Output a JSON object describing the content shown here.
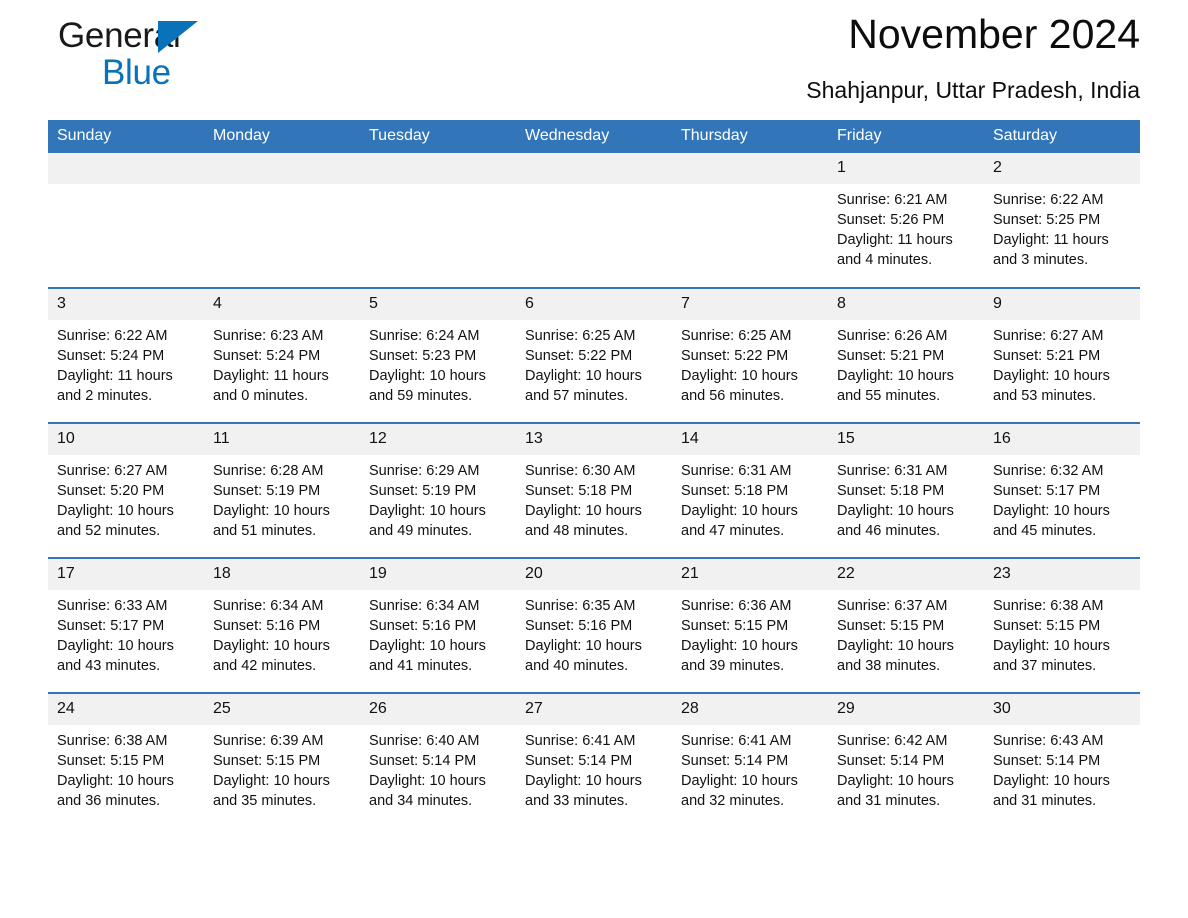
{
  "brand": {
    "name_part1": "General",
    "name_part2": "Blue",
    "triangle_color": "#0a72b8",
    "accent_color": "#3275b8"
  },
  "header": {
    "title": "November 2024",
    "subtitle": "Shahjanpur, Uttar Pradesh, India"
  },
  "calendar": {
    "weekday_headers": [
      "Sunday",
      "Monday",
      "Tuesday",
      "Wednesday",
      "Thursday",
      "Friday",
      "Saturday"
    ],
    "header_bg": "#3275b8",
    "header_text_color": "#ffffff",
    "daynum_bg": "#f1f1f1",
    "weeks": [
      [
        {
          "day": "",
          "sunrise": "",
          "sunset": "",
          "daylight_line1": "",
          "daylight_line2": ""
        },
        {
          "day": "",
          "sunrise": "",
          "sunset": "",
          "daylight_line1": "",
          "daylight_line2": ""
        },
        {
          "day": "",
          "sunrise": "",
          "sunset": "",
          "daylight_line1": "",
          "daylight_line2": ""
        },
        {
          "day": "",
          "sunrise": "",
          "sunset": "",
          "daylight_line1": "",
          "daylight_line2": ""
        },
        {
          "day": "",
          "sunrise": "",
          "sunset": "",
          "daylight_line1": "",
          "daylight_line2": ""
        },
        {
          "day": "1",
          "sunrise": "Sunrise: 6:21 AM",
          "sunset": "Sunset: 5:26 PM",
          "daylight_line1": "Daylight: 11 hours",
          "daylight_line2": "and 4 minutes."
        },
        {
          "day": "2",
          "sunrise": "Sunrise: 6:22 AM",
          "sunset": "Sunset: 5:25 PM",
          "daylight_line1": "Daylight: 11 hours",
          "daylight_line2": "and 3 minutes."
        }
      ],
      [
        {
          "day": "3",
          "sunrise": "Sunrise: 6:22 AM",
          "sunset": "Sunset: 5:24 PM",
          "daylight_line1": "Daylight: 11 hours",
          "daylight_line2": "and 2 minutes."
        },
        {
          "day": "4",
          "sunrise": "Sunrise: 6:23 AM",
          "sunset": "Sunset: 5:24 PM",
          "daylight_line1": "Daylight: 11 hours",
          "daylight_line2": "and 0 minutes."
        },
        {
          "day": "5",
          "sunrise": "Sunrise: 6:24 AM",
          "sunset": "Sunset: 5:23 PM",
          "daylight_line1": "Daylight: 10 hours",
          "daylight_line2": "and 59 minutes."
        },
        {
          "day": "6",
          "sunrise": "Sunrise: 6:25 AM",
          "sunset": "Sunset: 5:22 PM",
          "daylight_line1": "Daylight: 10 hours",
          "daylight_line2": "and 57 minutes."
        },
        {
          "day": "7",
          "sunrise": "Sunrise: 6:25 AM",
          "sunset": "Sunset: 5:22 PM",
          "daylight_line1": "Daylight: 10 hours",
          "daylight_line2": "and 56 minutes."
        },
        {
          "day": "8",
          "sunrise": "Sunrise: 6:26 AM",
          "sunset": "Sunset: 5:21 PM",
          "daylight_line1": "Daylight: 10 hours",
          "daylight_line2": "and 55 minutes."
        },
        {
          "day": "9",
          "sunrise": "Sunrise: 6:27 AM",
          "sunset": "Sunset: 5:21 PM",
          "daylight_line1": "Daylight: 10 hours",
          "daylight_line2": "and 53 minutes."
        }
      ],
      [
        {
          "day": "10",
          "sunrise": "Sunrise: 6:27 AM",
          "sunset": "Sunset: 5:20 PM",
          "daylight_line1": "Daylight: 10 hours",
          "daylight_line2": "and 52 minutes."
        },
        {
          "day": "11",
          "sunrise": "Sunrise: 6:28 AM",
          "sunset": "Sunset: 5:19 PM",
          "daylight_line1": "Daylight: 10 hours",
          "daylight_line2": "and 51 minutes."
        },
        {
          "day": "12",
          "sunrise": "Sunrise: 6:29 AM",
          "sunset": "Sunset: 5:19 PM",
          "daylight_line1": "Daylight: 10 hours",
          "daylight_line2": "and 49 minutes."
        },
        {
          "day": "13",
          "sunrise": "Sunrise: 6:30 AM",
          "sunset": "Sunset: 5:18 PM",
          "daylight_line1": "Daylight: 10 hours",
          "daylight_line2": "and 48 minutes."
        },
        {
          "day": "14",
          "sunrise": "Sunrise: 6:31 AM",
          "sunset": "Sunset: 5:18 PM",
          "daylight_line1": "Daylight: 10 hours",
          "daylight_line2": "and 47 minutes."
        },
        {
          "day": "15",
          "sunrise": "Sunrise: 6:31 AM",
          "sunset": "Sunset: 5:18 PM",
          "daylight_line1": "Daylight: 10 hours",
          "daylight_line2": "and 46 minutes."
        },
        {
          "day": "16",
          "sunrise": "Sunrise: 6:32 AM",
          "sunset": "Sunset: 5:17 PM",
          "daylight_line1": "Daylight: 10 hours",
          "daylight_line2": "and 45 minutes."
        }
      ],
      [
        {
          "day": "17",
          "sunrise": "Sunrise: 6:33 AM",
          "sunset": "Sunset: 5:17 PM",
          "daylight_line1": "Daylight: 10 hours",
          "daylight_line2": "and 43 minutes."
        },
        {
          "day": "18",
          "sunrise": "Sunrise: 6:34 AM",
          "sunset": "Sunset: 5:16 PM",
          "daylight_line1": "Daylight: 10 hours",
          "daylight_line2": "and 42 minutes."
        },
        {
          "day": "19",
          "sunrise": "Sunrise: 6:34 AM",
          "sunset": "Sunset: 5:16 PM",
          "daylight_line1": "Daylight: 10 hours",
          "daylight_line2": "and 41 minutes."
        },
        {
          "day": "20",
          "sunrise": "Sunrise: 6:35 AM",
          "sunset": "Sunset: 5:16 PM",
          "daylight_line1": "Daylight: 10 hours",
          "daylight_line2": "and 40 minutes."
        },
        {
          "day": "21",
          "sunrise": "Sunrise: 6:36 AM",
          "sunset": "Sunset: 5:15 PM",
          "daylight_line1": "Daylight: 10 hours",
          "daylight_line2": "and 39 minutes."
        },
        {
          "day": "22",
          "sunrise": "Sunrise: 6:37 AM",
          "sunset": "Sunset: 5:15 PM",
          "daylight_line1": "Daylight: 10 hours",
          "daylight_line2": "and 38 minutes."
        },
        {
          "day": "23",
          "sunrise": "Sunrise: 6:38 AM",
          "sunset": "Sunset: 5:15 PM",
          "daylight_line1": "Daylight: 10 hours",
          "daylight_line2": "and 37 minutes."
        }
      ],
      [
        {
          "day": "24",
          "sunrise": "Sunrise: 6:38 AM",
          "sunset": "Sunset: 5:15 PM",
          "daylight_line1": "Daylight: 10 hours",
          "daylight_line2": "and 36 minutes."
        },
        {
          "day": "25",
          "sunrise": "Sunrise: 6:39 AM",
          "sunset": "Sunset: 5:15 PM",
          "daylight_line1": "Daylight: 10 hours",
          "daylight_line2": "and 35 minutes."
        },
        {
          "day": "26",
          "sunrise": "Sunrise: 6:40 AM",
          "sunset": "Sunset: 5:14 PM",
          "daylight_line1": "Daylight: 10 hours",
          "daylight_line2": "and 34 minutes."
        },
        {
          "day": "27",
          "sunrise": "Sunrise: 6:41 AM",
          "sunset": "Sunset: 5:14 PM",
          "daylight_line1": "Daylight: 10 hours",
          "daylight_line2": "and 33 minutes."
        },
        {
          "day": "28",
          "sunrise": "Sunrise: 6:41 AM",
          "sunset": "Sunset: 5:14 PM",
          "daylight_line1": "Daylight: 10 hours",
          "daylight_line2": "and 32 minutes."
        },
        {
          "day": "29",
          "sunrise": "Sunrise: 6:42 AM",
          "sunset": "Sunset: 5:14 PM",
          "daylight_line1": "Daylight: 10 hours",
          "daylight_line2": "and 31 minutes."
        },
        {
          "day": "30",
          "sunrise": "Sunrise: 6:43 AM",
          "sunset": "Sunset: 5:14 PM",
          "daylight_line1": "Daylight: 10 hours",
          "daylight_line2": "and 31 minutes."
        }
      ]
    ]
  }
}
